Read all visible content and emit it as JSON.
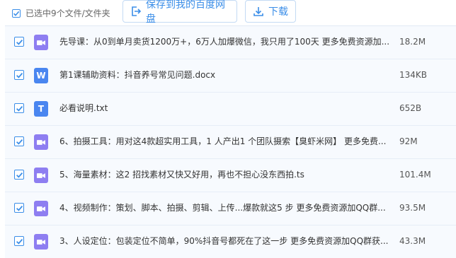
{
  "toolbar": {
    "selected_text": "已选中9个文件/文件夹",
    "save_label": "保存到我的百度网盘",
    "download_label": "下载"
  },
  "colors": {
    "accent": "#3b8ee8",
    "video_icon": "#8e7ef1",
    "doc_icon": "#4a86f0"
  },
  "files": [
    {
      "icon": "video-icon",
      "name": "先导课：从0到单月卖货1200万+，6万人加爆微信，我只用了100天 更多免费资源加...",
      "size": "18.2M"
    },
    {
      "icon": "word-icon",
      "icon_letter": "W",
      "name": "第1课辅助资料：抖音养号常见问题.docx",
      "size": "134KB"
    },
    {
      "icon": "txt-icon",
      "icon_letter": "T",
      "name": "必看说明.txt",
      "size": "652B"
    },
    {
      "icon": "video-icon",
      "name": "6、拍摄工具：用对这4款超实用工具，1 人产出1 个团队摄索【臭虾米网】 更多免费...",
      "size": "92M"
    },
    {
      "icon": "video-icon",
      "name": "5、海量素材：这2 招找素材又快又好用，再也不担心没东西拍.ts",
      "size": "101.4M"
    },
    {
      "icon": "video-icon",
      "name": "4、视频制作：策划、脚本、拍摄、剪辑、上传...爆款就这5 步 更多免费资源加QQ群...",
      "size": "93.5M"
    },
    {
      "icon": "video-icon",
      "name": "3、人设定位：包装定位不简单，90%抖音号都死在了这一步 更多免费资源加QQ群获...",
      "size": "43.3M"
    }
  ]
}
